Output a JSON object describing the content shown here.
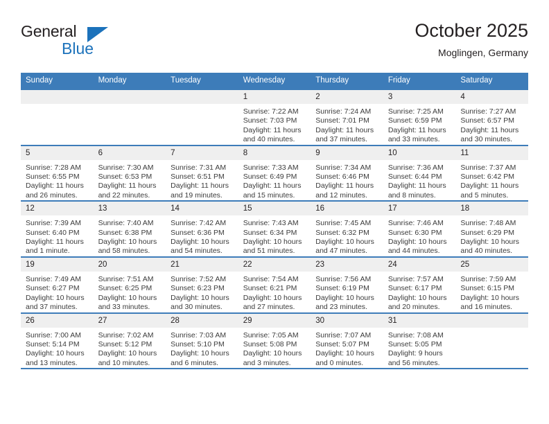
{
  "logo": {
    "word_top": "General",
    "word_bottom": "Blue",
    "triangle_color": "#1c72bb"
  },
  "header": {
    "title": "October 2025",
    "subtitle": "Moglingen, Germany"
  },
  "colors": {
    "header_blue": "#3d7cb9",
    "daynum_gray": "#efefef",
    "text": "#231f20"
  },
  "calendar": {
    "weekday_headers": [
      "Sunday",
      "Monday",
      "Tuesday",
      "Wednesday",
      "Thursday",
      "Friday",
      "Saturday"
    ],
    "weeks": [
      [
        {
          "day": "",
          "empty": true
        },
        {
          "day": "",
          "empty": true
        },
        {
          "day": "",
          "empty": true
        },
        {
          "day": "1",
          "sunrise": "Sunrise: 7:22 AM",
          "sunset": "Sunset: 7:03 PM",
          "daylight1": "Daylight: 11 hours",
          "daylight2": "and 40 minutes."
        },
        {
          "day": "2",
          "sunrise": "Sunrise: 7:24 AM",
          "sunset": "Sunset: 7:01 PM",
          "daylight1": "Daylight: 11 hours",
          "daylight2": "and 37 minutes."
        },
        {
          "day": "3",
          "sunrise": "Sunrise: 7:25 AM",
          "sunset": "Sunset: 6:59 PM",
          "daylight1": "Daylight: 11 hours",
          "daylight2": "and 33 minutes."
        },
        {
          "day": "4",
          "sunrise": "Sunrise: 7:27 AM",
          "sunset": "Sunset: 6:57 PM",
          "daylight1": "Daylight: 11 hours",
          "daylight2": "and 30 minutes."
        }
      ],
      [
        {
          "day": "5",
          "sunrise": "Sunrise: 7:28 AM",
          "sunset": "Sunset: 6:55 PM",
          "daylight1": "Daylight: 11 hours",
          "daylight2": "and 26 minutes."
        },
        {
          "day": "6",
          "sunrise": "Sunrise: 7:30 AM",
          "sunset": "Sunset: 6:53 PM",
          "daylight1": "Daylight: 11 hours",
          "daylight2": "and 22 minutes."
        },
        {
          "day": "7",
          "sunrise": "Sunrise: 7:31 AM",
          "sunset": "Sunset: 6:51 PM",
          "daylight1": "Daylight: 11 hours",
          "daylight2": "and 19 minutes."
        },
        {
          "day": "8",
          "sunrise": "Sunrise: 7:33 AM",
          "sunset": "Sunset: 6:49 PM",
          "daylight1": "Daylight: 11 hours",
          "daylight2": "and 15 minutes."
        },
        {
          "day": "9",
          "sunrise": "Sunrise: 7:34 AM",
          "sunset": "Sunset: 6:46 PM",
          "daylight1": "Daylight: 11 hours",
          "daylight2": "and 12 minutes."
        },
        {
          "day": "10",
          "sunrise": "Sunrise: 7:36 AM",
          "sunset": "Sunset: 6:44 PM",
          "daylight1": "Daylight: 11 hours",
          "daylight2": "and 8 minutes."
        },
        {
          "day": "11",
          "sunrise": "Sunrise: 7:37 AM",
          "sunset": "Sunset: 6:42 PM",
          "daylight1": "Daylight: 11 hours",
          "daylight2": "and 5 minutes."
        }
      ],
      [
        {
          "day": "12",
          "sunrise": "Sunrise: 7:39 AM",
          "sunset": "Sunset: 6:40 PM",
          "daylight1": "Daylight: 11 hours",
          "daylight2": "and 1 minute."
        },
        {
          "day": "13",
          "sunrise": "Sunrise: 7:40 AM",
          "sunset": "Sunset: 6:38 PM",
          "daylight1": "Daylight: 10 hours",
          "daylight2": "and 58 minutes."
        },
        {
          "day": "14",
          "sunrise": "Sunrise: 7:42 AM",
          "sunset": "Sunset: 6:36 PM",
          "daylight1": "Daylight: 10 hours",
          "daylight2": "and 54 minutes."
        },
        {
          "day": "15",
          "sunrise": "Sunrise: 7:43 AM",
          "sunset": "Sunset: 6:34 PM",
          "daylight1": "Daylight: 10 hours",
          "daylight2": "and 51 minutes."
        },
        {
          "day": "16",
          "sunrise": "Sunrise: 7:45 AM",
          "sunset": "Sunset: 6:32 PM",
          "daylight1": "Daylight: 10 hours",
          "daylight2": "and 47 minutes."
        },
        {
          "day": "17",
          "sunrise": "Sunrise: 7:46 AM",
          "sunset": "Sunset: 6:30 PM",
          "daylight1": "Daylight: 10 hours",
          "daylight2": "and 44 minutes."
        },
        {
          "day": "18",
          "sunrise": "Sunrise: 7:48 AM",
          "sunset": "Sunset: 6:29 PM",
          "daylight1": "Daylight: 10 hours",
          "daylight2": "and 40 minutes."
        }
      ],
      [
        {
          "day": "19",
          "sunrise": "Sunrise: 7:49 AM",
          "sunset": "Sunset: 6:27 PM",
          "daylight1": "Daylight: 10 hours",
          "daylight2": "and 37 minutes."
        },
        {
          "day": "20",
          "sunrise": "Sunrise: 7:51 AM",
          "sunset": "Sunset: 6:25 PM",
          "daylight1": "Daylight: 10 hours",
          "daylight2": "and 33 minutes."
        },
        {
          "day": "21",
          "sunrise": "Sunrise: 7:52 AM",
          "sunset": "Sunset: 6:23 PM",
          "daylight1": "Daylight: 10 hours",
          "daylight2": "and 30 minutes."
        },
        {
          "day": "22",
          "sunrise": "Sunrise: 7:54 AM",
          "sunset": "Sunset: 6:21 PM",
          "daylight1": "Daylight: 10 hours",
          "daylight2": "and 27 minutes."
        },
        {
          "day": "23",
          "sunrise": "Sunrise: 7:56 AM",
          "sunset": "Sunset: 6:19 PM",
          "daylight1": "Daylight: 10 hours",
          "daylight2": "and 23 minutes."
        },
        {
          "day": "24",
          "sunrise": "Sunrise: 7:57 AM",
          "sunset": "Sunset: 6:17 PM",
          "daylight1": "Daylight: 10 hours",
          "daylight2": "and 20 minutes."
        },
        {
          "day": "25",
          "sunrise": "Sunrise: 7:59 AM",
          "sunset": "Sunset: 6:15 PM",
          "daylight1": "Daylight: 10 hours",
          "daylight2": "and 16 minutes."
        }
      ],
      [
        {
          "day": "26",
          "sunrise": "Sunrise: 7:00 AM",
          "sunset": "Sunset: 5:14 PM",
          "daylight1": "Daylight: 10 hours",
          "daylight2": "and 13 minutes."
        },
        {
          "day": "27",
          "sunrise": "Sunrise: 7:02 AM",
          "sunset": "Sunset: 5:12 PM",
          "daylight1": "Daylight: 10 hours",
          "daylight2": "and 10 minutes."
        },
        {
          "day": "28",
          "sunrise": "Sunrise: 7:03 AM",
          "sunset": "Sunset: 5:10 PM",
          "daylight1": "Daylight: 10 hours",
          "daylight2": "and 6 minutes."
        },
        {
          "day": "29",
          "sunrise": "Sunrise: 7:05 AM",
          "sunset": "Sunset: 5:08 PM",
          "daylight1": "Daylight: 10 hours",
          "daylight2": "and 3 minutes."
        },
        {
          "day": "30",
          "sunrise": "Sunrise: 7:07 AM",
          "sunset": "Sunset: 5:07 PM",
          "daylight1": "Daylight: 10 hours",
          "daylight2": "and 0 minutes."
        },
        {
          "day": "31",
          "sunrise": "Sunrise: 7:08 AM",
          "sunset": "Sunset: 5:05 PM",
          "daylight1": "Daylight: 9 hours",
          "daylight2": "and 56 minutes."
        },
        {
          "day": "",
          "empty": true
        }
      ]
    ]
  }
}
